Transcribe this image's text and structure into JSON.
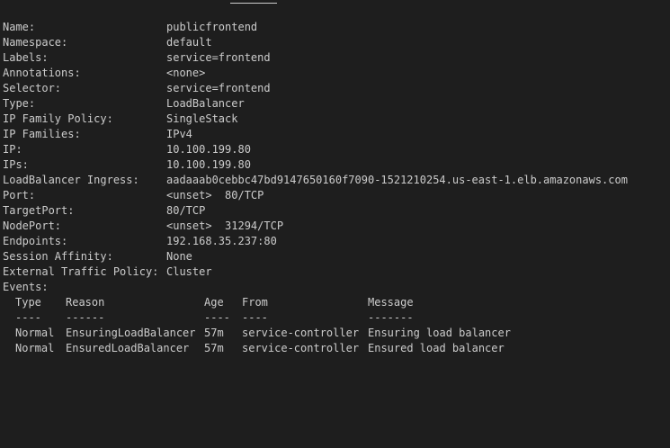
{
  "fields": [
    {
      "key": "Name:",
      "value": "publicfrontend"
    },
    {
      "key": "Namespace:",
      "value": "default"
    },
    {
      "key": "Labels:",
      "value": "service=frontend"
    },
    {
      "key": "Annotations:",
      "value": "<none>"
    },
    {
      "key": "Selector:",
      "value": "service=frontend"
    },
    {
      "key": "Type:",
      "value": "LoadBalancer"
    },
    {
      "key": "IP Family Policy:",
      "value": "SingleStack"
    },
    {
      "key": "IP Families:",
      "value": "IPv4"
    },
    {
      "key": "IP:",
      "value": "10.100.199.80"
    },
    {
      "key": "IPs:",
      "value": "10.100.199.80"
    },
    {
      "key": "LoadBalancer Ingress:",
      "value": "aadaaab0cebbc47bd9147650160f7090-1521210254.us-east-1.elb.amazonaws.com"
    },
    {
      "key": "Port:",
      "value": "<unset>  80/TCP"
    },
    {
      "key": "TargetPort:",
      "value": "80/TCP"
    },
    {
      "key": "NodePort:",
      "value": "<unset>  31294/TCP"
    },
    {
      "key": "Endpoints:",
      "value": "192.168.35.237:80"
    },
    {
      "key": "Session Affinity:",
      "value": "None"
    },
    {
      "key": "External Traffic Policy:",
      "value": "Cluster"
    }
  ],
  "events": {
    "label": "Events:",
    "columns": {
      "type": "Type",
      "reason": "Reason",
      "age": "Age",
      "from": "From",
      "message": "Message"
    },
    "separators": {
      "type": "----",
      "reason": "------",
      "age": "----",
      "from": "----",
      "message": "-------"
    },
    "rows": [
      {
        "type": "Normal",
        "reason": "EnsuringLoadBalancer",
        "age": "57m",
        "from": "service-controller",
        "message": "Ensuring load balancer"
      },
      {
        "type": "Normal",
        "reason": "EnsuredLoadBalancer",
        "age": "57m",
        "from": "service-controller",
        "message": "Ensured load balancer"
      }
    ]
  }
}
